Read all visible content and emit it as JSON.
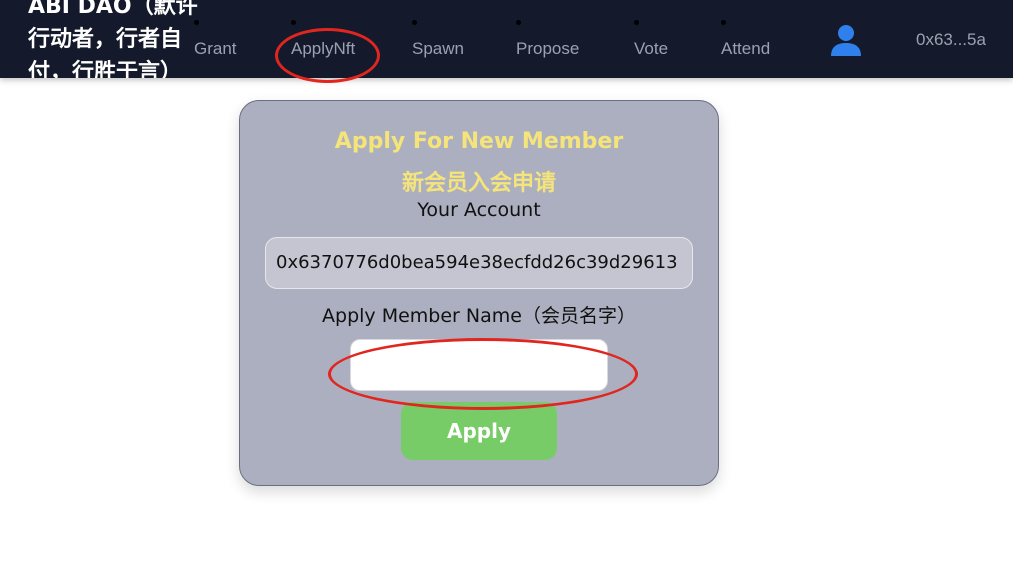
{
  "navbar": {
    "brand": "ABI DAO（默许行动者，行者自付，行胜于言）",
    "items": [
      {
        "label": "Grant"
      },
      {
        "label": "ApplyNft"
      },
      {
        "label": "Spawn"
      },
      {
        "label": "Propose"
      },
      {
        "label": "Vote"
      },
      {
        "label": "Attend"
      }
    ],
    "account": "0x63...5a",
    "user_icon": "user-icon"
  },
  "form": {
    "title_en": "Apply For New Member",
    "title_zh": "新会员入会申请",
    "account_label": "Your Account",
    "account_value": "0x6370776d0bea594e38ecfdd26c39d29613",
    "name_label": "Apply Member Name（会员名字）",
    "name_value": "",
    "name_placeholder": "",
    "apply_label": "Apply"
  },
  "colors": {
    "navbar_bg": "#141a2b",
    "card_bg": "#acafbf",
    "title_color": "#f5e47a",
    "apply_button": "#78cc68",
    "highlight_circle": "#e0261f",
    "user_icon": "#2f80ed"
  }
}
